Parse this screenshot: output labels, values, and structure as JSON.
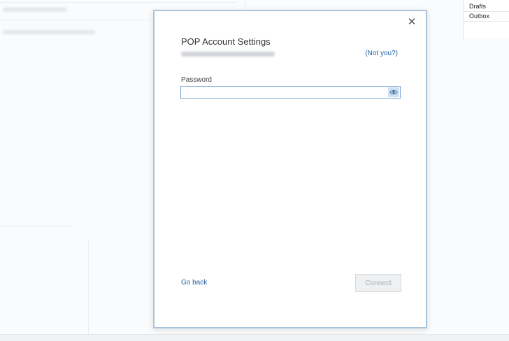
{
  "folders": {
    "items": [
      "Drafts",
      "Outbox"
    ]
  },
  "dialog": {
    "title": "POP Account Settings",
    "not_you": "(Not you?)",
    "password_label": "Password",
    "password_value": "",
    "go_back": "Go back",
    "connect": "Connect",
    "close": "✕"
  },
  "colors": {
    "link": "#1f5fa8",
    "dialog_border": "#a9c4dc",
    "input_border": "#7aa7d4",
    "disabled_button_bg": "#eef0f2"
  },
  "icons": {
    "close": "close-icon",
    "reveal_password": "eye-icon"
  }
}
